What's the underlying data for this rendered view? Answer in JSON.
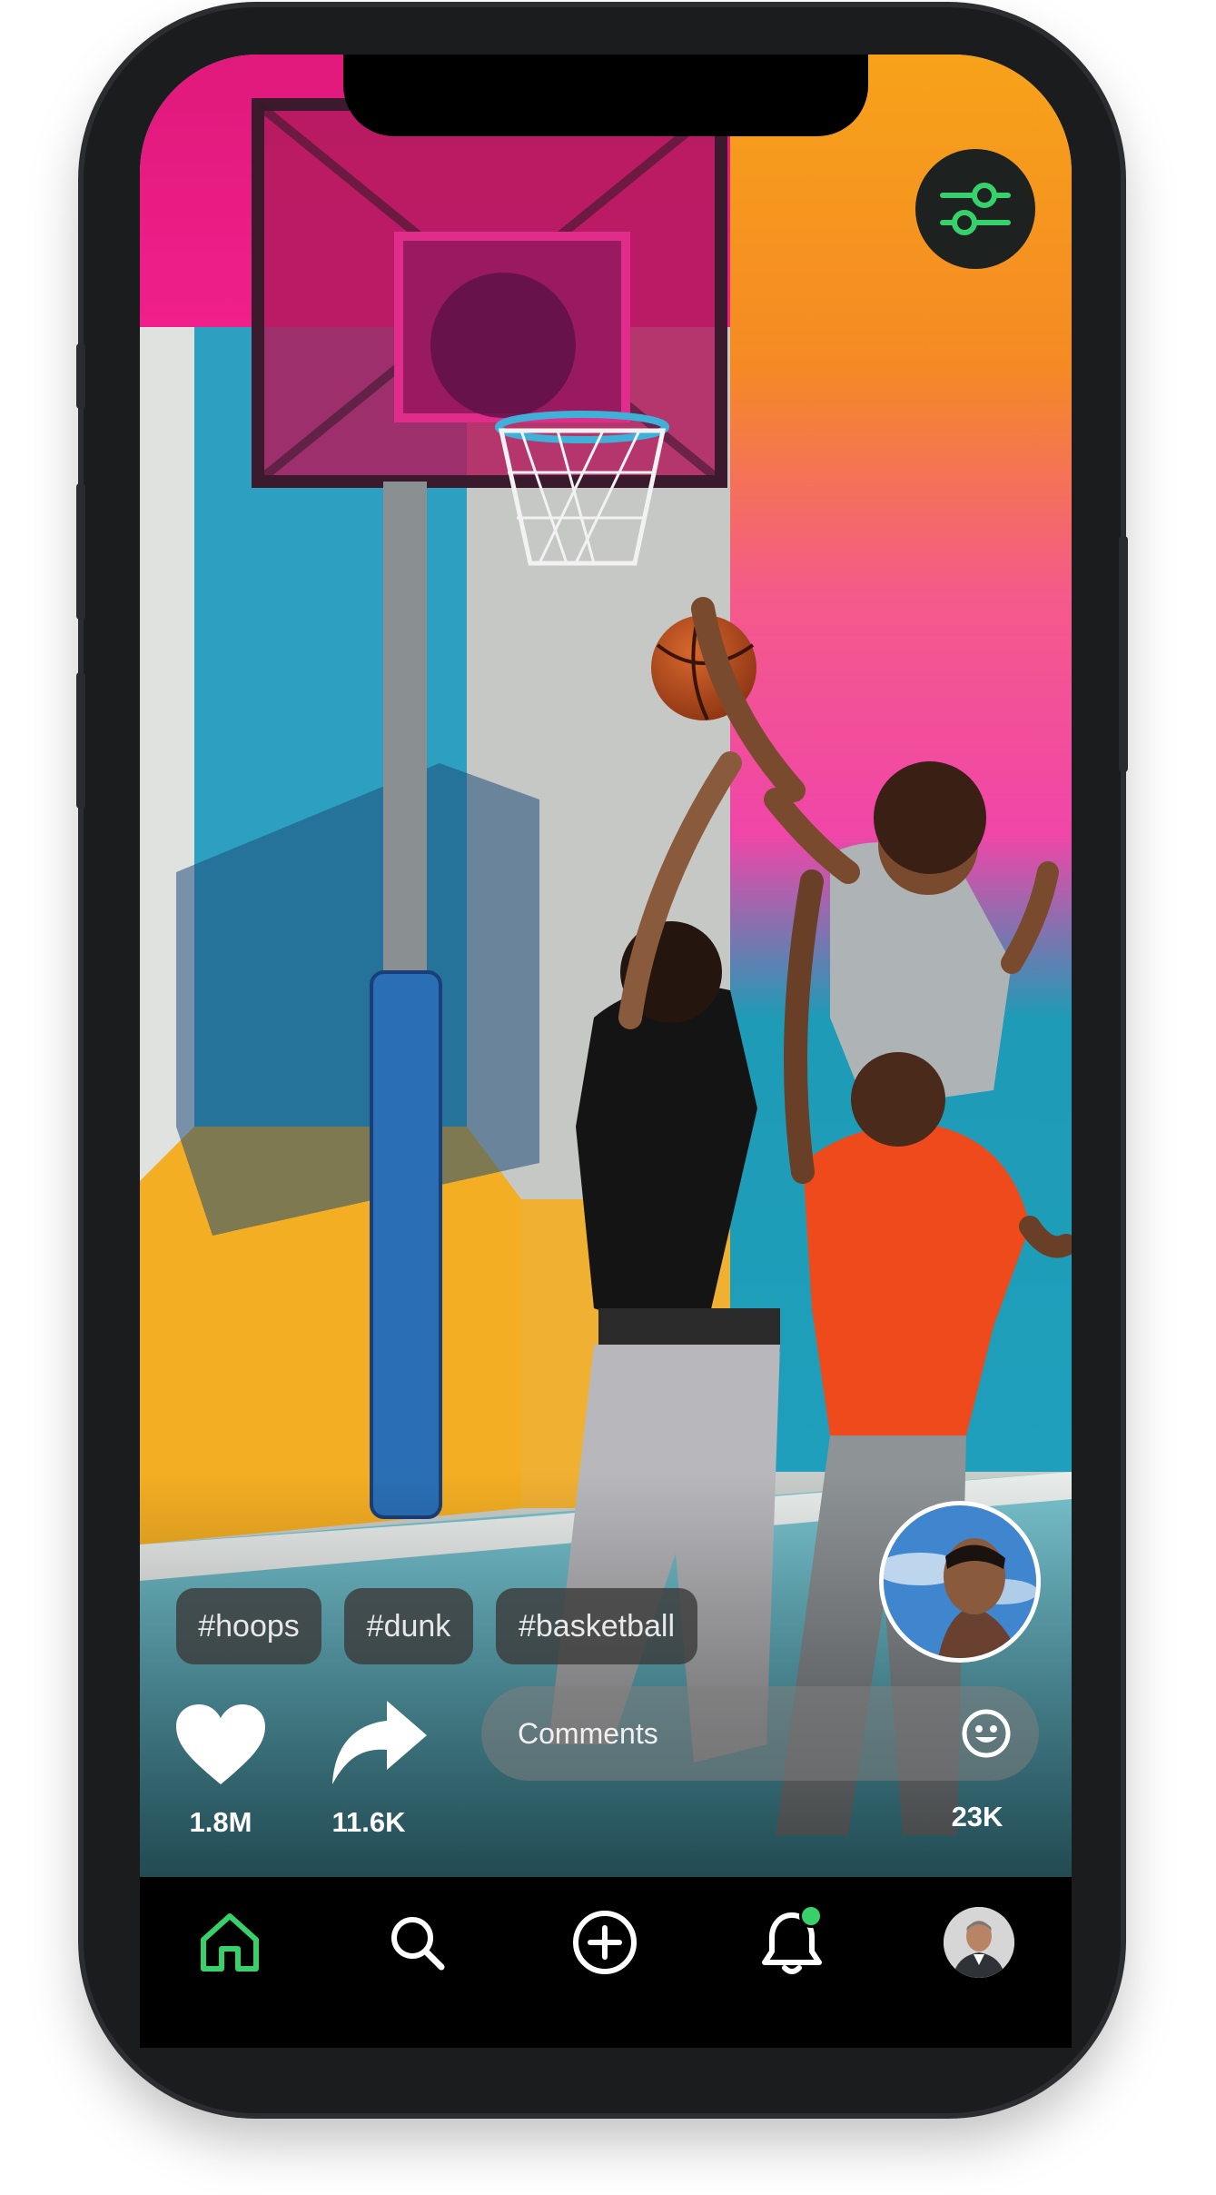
{
  "hashtags": [
    "#hoops",
    "#dunk",
    "#basketball"
  ],
  "actions": {
    "likes_count": "1.8M",
    "shares_count": "11.6K",
    "comments_count": "23K"
  },
  "comments": {
    "placeholder": "Comments"
  },
  "tabs": [
    {
      "name": "home",
      "icon": "home-icon",
      "active": true
    },
    {
      "name": "search",
      "icon": "search-icon",
      "active": false
    },
    {
      "name": "create",
      "icon": "add-circle-icon",
      "active": false
    },
    {
      "name": "notifications",
      "icon": "bell-icon",
      "active": false,
      "has_badge": true
    },
    {
      "name": "profile",
      "icon": "avatar",
      "active": false
    }
  ],
  "colors": {
    "accent": "#36d16b",
    "tabbar_bg": "#000000",
    "chip_bg": "#3c3c3c"
  }
}
